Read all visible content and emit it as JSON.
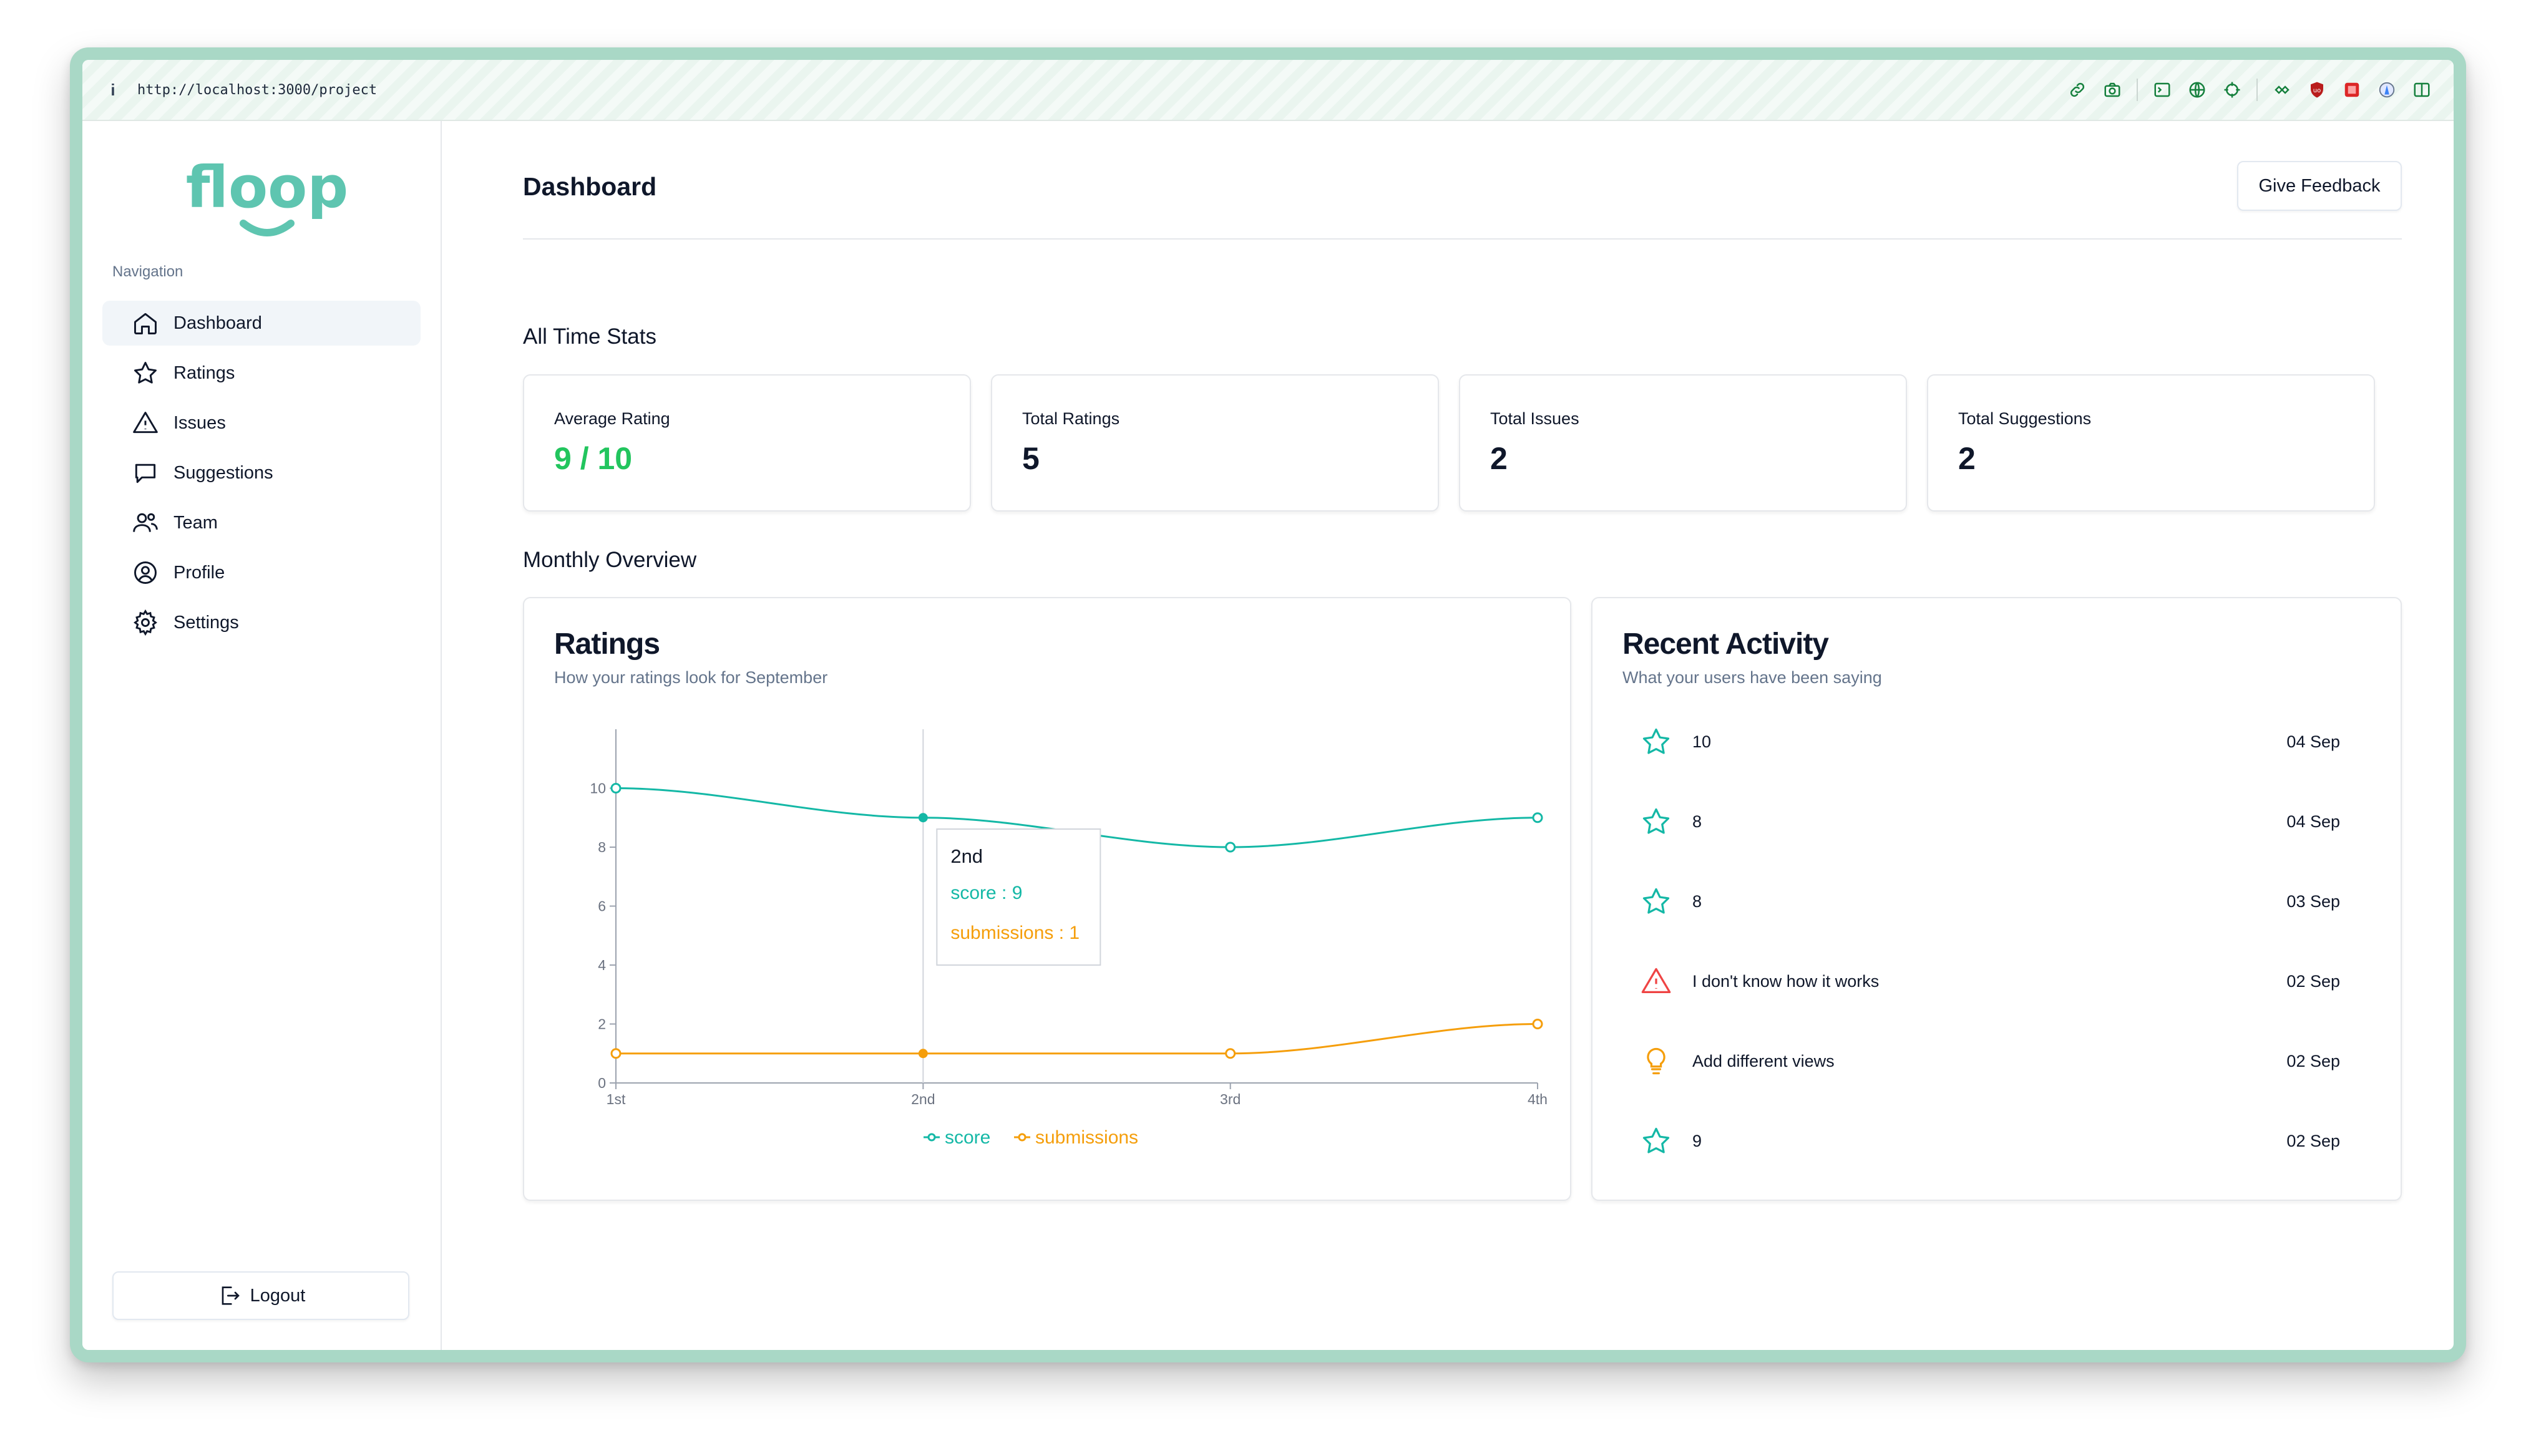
{
  "browser": {
    "url": "http://localhost:3000/project",
    "info_icon": "i",
    "toolbar_icons": [
      "link-icon",
      "camera-icon",
      "terminal-icon",
      "globe-icon",
      "crosshair-icon",
      "extensions-icon",
      "ublock-icon",
      "image-extension-icon",
      "lighthouse-icon",
      "split-view-icon"
    ]
  },
  "sidebar": {
    "logo_text": "floop",
    "nav_heading": "Navigation",
    "items": [
      {
        "label": "Dashboard",
        "icon": "home-icon",
        "active": true
      },
      {
        "label": "Ratings",
        "icon": "star-icon",
        "active": false
      },
      {
        "label": "Issues",
        "icon": "warning-icon",
        "active": false
      },
      {
        "label": "Suggestions",
        "icon": "message-icon",
        "active": false
      },
      {
        "label": "Team",
        "icon": "users-icon",
        "active": false
      },
      {
        "label": "Profile",
        "icon": "user-circle-icon",
        "active": false
      },
      {
        "label": "Settings",
        "icon": "gear-icon",
        "active": false
      }
    ],
    "logout_label": "Logout"
  },
  "header": {
    "title": "Dashboard",
    "feedback_label": "Give Feedback"
  },
  "stats": {
    "section_title": "All Time Stats",
    "cards": [
      {
        "label": "Average Rating",
        "value": "9 / 10"
      },
      {
        "label": "Total Ratings",
        "value": "5"
      },
      {
        "label": "Total Issues",
        "value": "2"
      },
      {
        "label": "Total Suggestions",
        "value": "2"
      }
    ]
  },
  "monthly": {
    "section_title": "Monthly Overview"
  },
  "ratings_panel": {
    "title": "Ratings",
    "subtitle": "How your ratings look for September"
  },
  "chart_data": {
    "type": "line",
    "title": "Ratings",
    "subtitle": "How your ratings look for September",
    "categories": [
      "1st",
      "2nd",
      "3rd",
      "4th"
    ],
    "y_ticks": [
      0,
      2,
      4,
      6,
      8,
      10
    ],
    "ylim": [
      0,
      12
    ],
    "series": [
      {
        "name": "score",
        "color": "#14b8a6",
        "values": [
          10,
          9,
          8,
          9
        ]
      },
      {
        "name": "submissions",
        "color": "#f59e0b",
        "values": [
          1,
          1,
          1,
          2
        ]
      }
    ],
    "legend_position": "bottom-center",
    "tooltip": {
      "category": "2nd",
      "lines": [
        "score : 9",
        "submissions : 1"
      ]
    }
  },
  "activity_panel": {
    "title": "Recent Activity",
    "subtitle": "What your users have been saying",
    "items": [
      {
        "type": "rating",
        "icon": "star-icon",
        "text": "10",
        "date": "04 Sep"
      },
      {
        "type": "rating",
        "icon": "star-icon",
        "text": "8",
        "date": "04 Sep"
      },
      {
        "type": "rating",
        "icon": "star-icon",
        "text": "8",
        "date": "03 Sep"
      },
      {
        "type": "issue",
        "icon": "warning-icon",
        "text": "I don't know how it works",
        "date": "02 Sep"
      },
      {
        "type": "suggestion",
        "icon": "lightbulb-icon",
        "text": "Add different views",
        "date": "02 Sep"
      },
      {
        "type": "rating",
        "icon": "star-icon",
        "text": "9",
        "date": "02 Sep"
      }
    ]
  },
  "colors": {
    "brand": "#5ec5b0",
    "score": "#14b8a6",
    "submissions": "#f59e0b",
    "issue": "#ef4444",
    "average_rating": "#22c55e"
  }
}
